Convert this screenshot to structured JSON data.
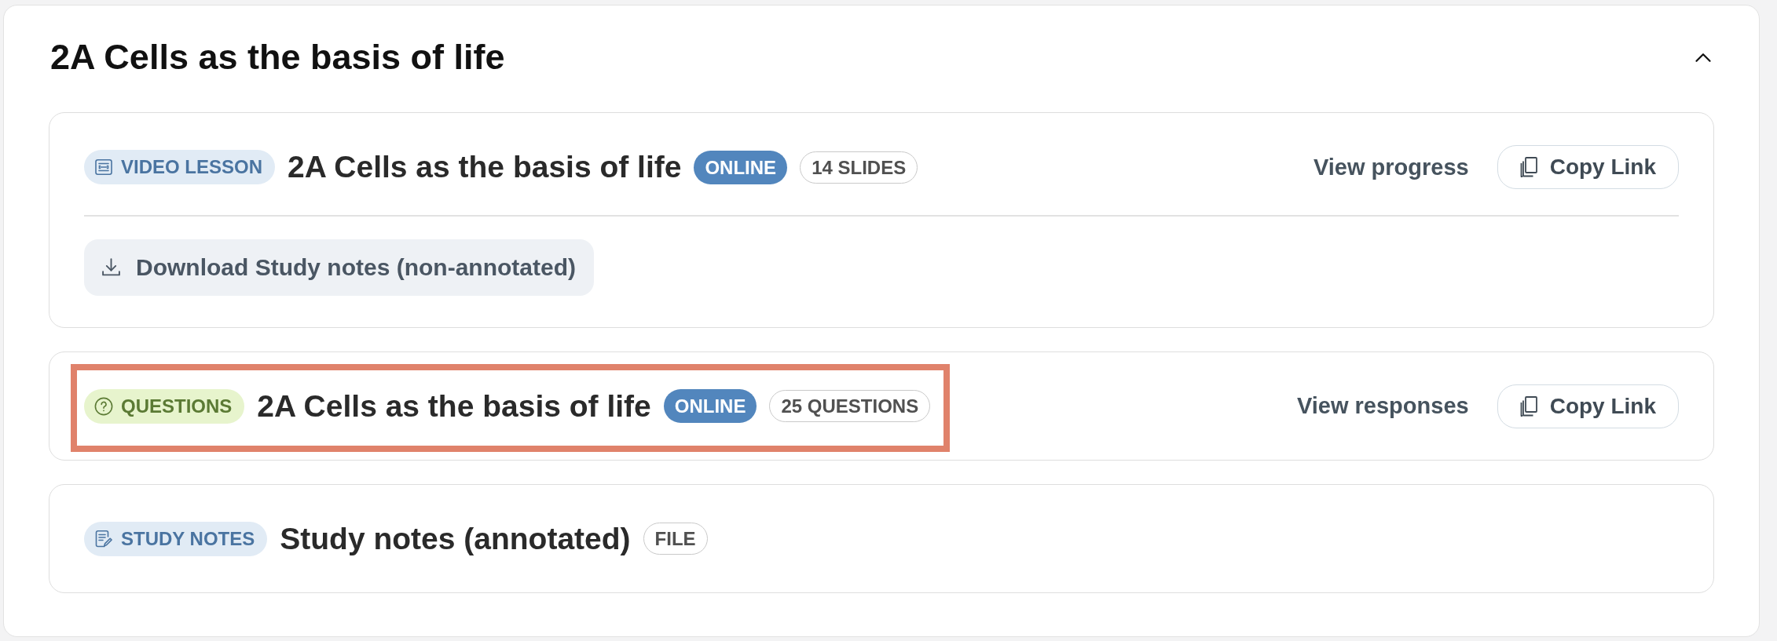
{
  "section": {
    "title": "2A Cells as the basis of life",
    "expanded": true
  },
  "items": [
    {
      "kind": "video_lesson",
      "type_label": "VIDEO LESSON",
      "title": "2A Cells as the basis of life",
      "status": "ONLINE",
      "count": "14 SLIDES",
      "highlighted": false,
      "action": "View progress",
      "button": "Copy Link",
      "download": "Download Study notes (non-annotated)"
    },
    {
      "kind": "questions",
      "type_label": "QUESTIONS",
      "title": "2A Cells as the basis of life",
      "status": "ONLINE",
      "count": "25 QUESTIONS",
      "highlighted": true,
      "action": "View responses",
      "button": "Copy Link"
    },
    {
      "kind": "study_notes",
      "type_label": "STUDY NOTES",
      "title": "Study notes (annotated)",
      "count": "FILE",
      "highlighted": false
    }
  ]
}
